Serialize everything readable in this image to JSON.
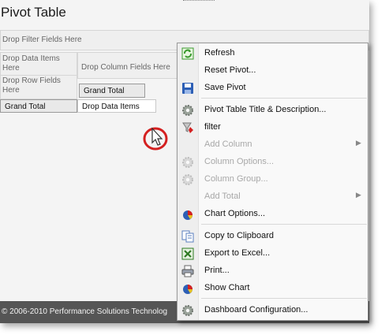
{
  "app": {
    "title": "Pivot Table",
    "zones": {
      "filter": "Drop Filter Fields Here",
      "data": "Drop Data Items Here",
      "column": "Drop Column Fields Here",
      "row": "Drop Row Fields Here"
    },
    "grid": {
      "grand_total_header": "Grand Total",
      "grand_total_row": "Grand Total",
      "data_items": "Drop Data Items"
    },
    "footer": "© 2006-2010 Performance Solutions Technolog"
  },
  "context_menu": {
    "items": [
      {
        "label": "Refresh",
        "icon": "refresh-icon",
        "enabled": true
      },
      {
        "label": "Reset Pivot...",
        "icon": "",
        "enabled": true
      },
      {
        "label": "Save Pivot",
        "icon": "save-icon",
        "enabled": true
      },
      {
        "label": "Pivot Table Title & Description...",
        "icon": "gear-icon",
        "enabled": true
      },
      {
        "label": "filter",
        "icon": "filter-icon",
        "enabled": true
      },
      {
        "label": "Add Column",
        "icon": "",
        "enabled": false,
        "submenu": true
      },
      {
        "label": "Column Options...",
        "icon": "gear-icon",
        "enabled": false
      },
      {
        "label": "Column Group...",
        "icon": "gear-icon",
        "enabled": false
      },
      {
        "label": "Add Total",
        "icon": "",
        "enabled": false,
        "submenu": true
      },
      {
        "label": "Chart Options...",
        "icon": "pie-chart-icon",
        "enabled": true
      },
      {
        "label": "Copy to Clipboard",
        "icon": "copy-icon",
        "enabled": true
      },
      {
        "label": "Export to Excel...",
        "icon": "excel-icon",
        "enabled": true
      },
      {
        "label": "Print...",
        "icon": "printer-icon",
        "enabled": true
      },
      {
        "label": "Show Chart",
        "icon": "pie-chart-icon",
        "enabled": true
      },
      {
        "label": "Dashboard Configuration...",
        "icon": "gear-icon",
        "enabled": true
      }
    ]
  },
  "colors": {
    "accent_green": "#3a9a2e",
    "footer_bg": "#555555",
    "annotation_red": "#d42020"
  }
}
